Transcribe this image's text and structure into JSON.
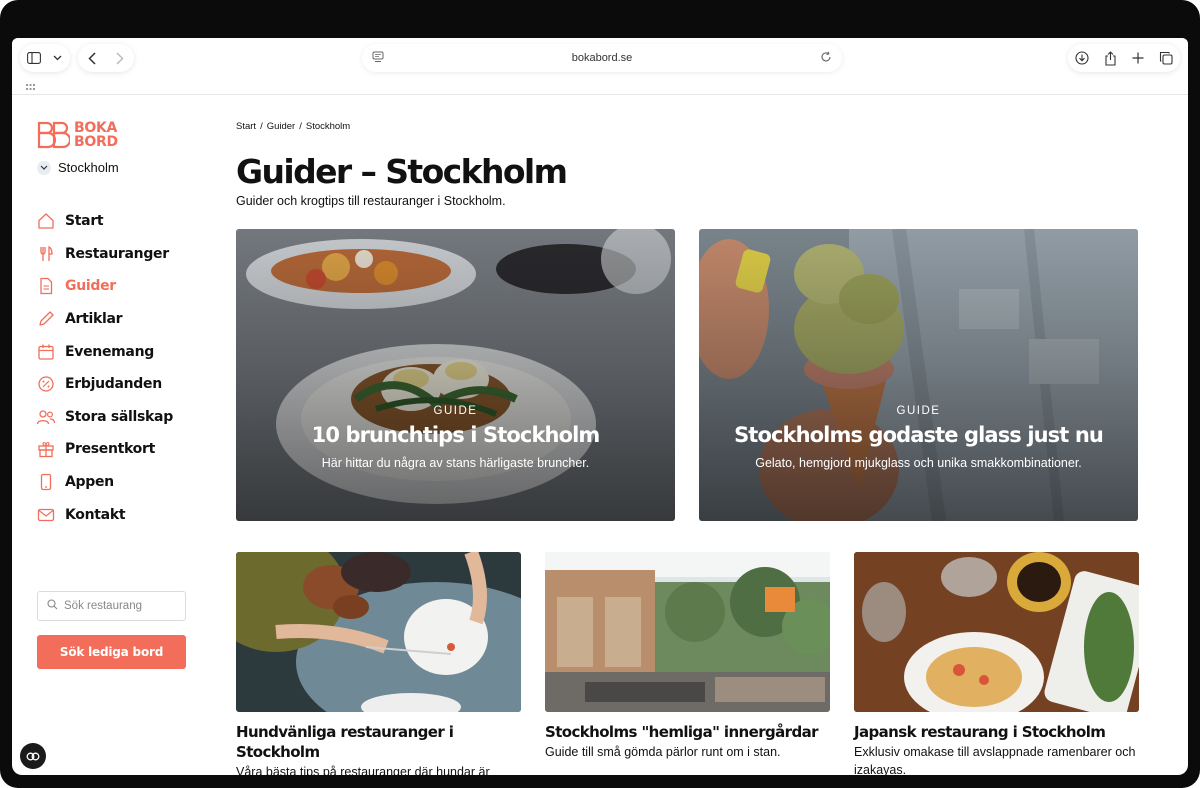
{
  "browser": {
    "url": "bokabord.se",
    "icons": [
      "sidebar-icon",
      "chevron-down-icon",
      "back-icon",
      "forward-icon",
      "reader-icon",
      "reload-icon",
      "download-icon",
      "share-icon",
      "new-tab-icon",
      "tabs-icon"
    ]
  },
  "brand": {
    "line1": "BOKA",
    "line2": "BORD",
    "color": "#f26e5b"
  },
  "city": "Stockholm",
  "nav": [
    {
      "label": "Start",
      "icon": "home-icon"
    },
    {
      "label": "Restauranger",
      "icon": "cutlery-icon"
    },
    {
      "label": "Guider",
      "icon": "document-icon",
      "active": true
    },
    {
      "label": "Artiklar",
      "icon": "pencil-icon"
    },
    {
      "label": "Evenemang",
      "icon": "calendar-icon"
    },
    {
      "label": "Erbjudanden",
      "icon": "percent-icon"
    },
    {
      "label": "Stora sällskap",
      "icon": "group-icon"
    },
    {
      "label": "Presentkort",
      "icon": "gift-icon"
    },
    {
      "label": "Appen",
      "icon": "phone-icon"
    },
    {
      "label": "Kontakt",
      "icon": "mail-icon"
    }
  ],
  "search": {
    "placeholder": "Sök restaurang"
  },
  "cta": "Sök lediga bord",
  "breadcrumb": [
    "Start",
    "Guider",
    "Stockholm"
  ],
  "page": {
    "title": "Guider – Stockholm",
    "subtitle": "Guider och krogtips till restauranger i Stockholm."
  },
  "featured": [
    {
      "tag": "GUIDE",
      "title": "10 brunchtips i Stockholm",
      "desc": "Här hittar du några av stans härligaste bruncher."
    },
    {
      "tag": "GUIDE",
      "title": "Stockholms godaste glass just nu",
      "desc": "Gelato, hemgjord mjukglass och unika smakkombinationer."
    }
  ],
  "cards": [
    {
      "title": "Hundvänliga restauranger i Stockholm",
      "desc": "Våra bästa tips på restauranger där hundar är"
    },
    {
      "title": "Stockholms \"hemliga\" innergårdar",
      "desc": "Guide till små gömda pärlor runt om i stan."
    },
    {
      "title": "Japansk restaurang i Stockholm",
      "desc": "Exklusiv omakase till avslappnade ramenbarer och izakayas."
    }
  ],
  "colors": {
    "accent": "#f26e5b",
    "text": "#111111"
  }
}
